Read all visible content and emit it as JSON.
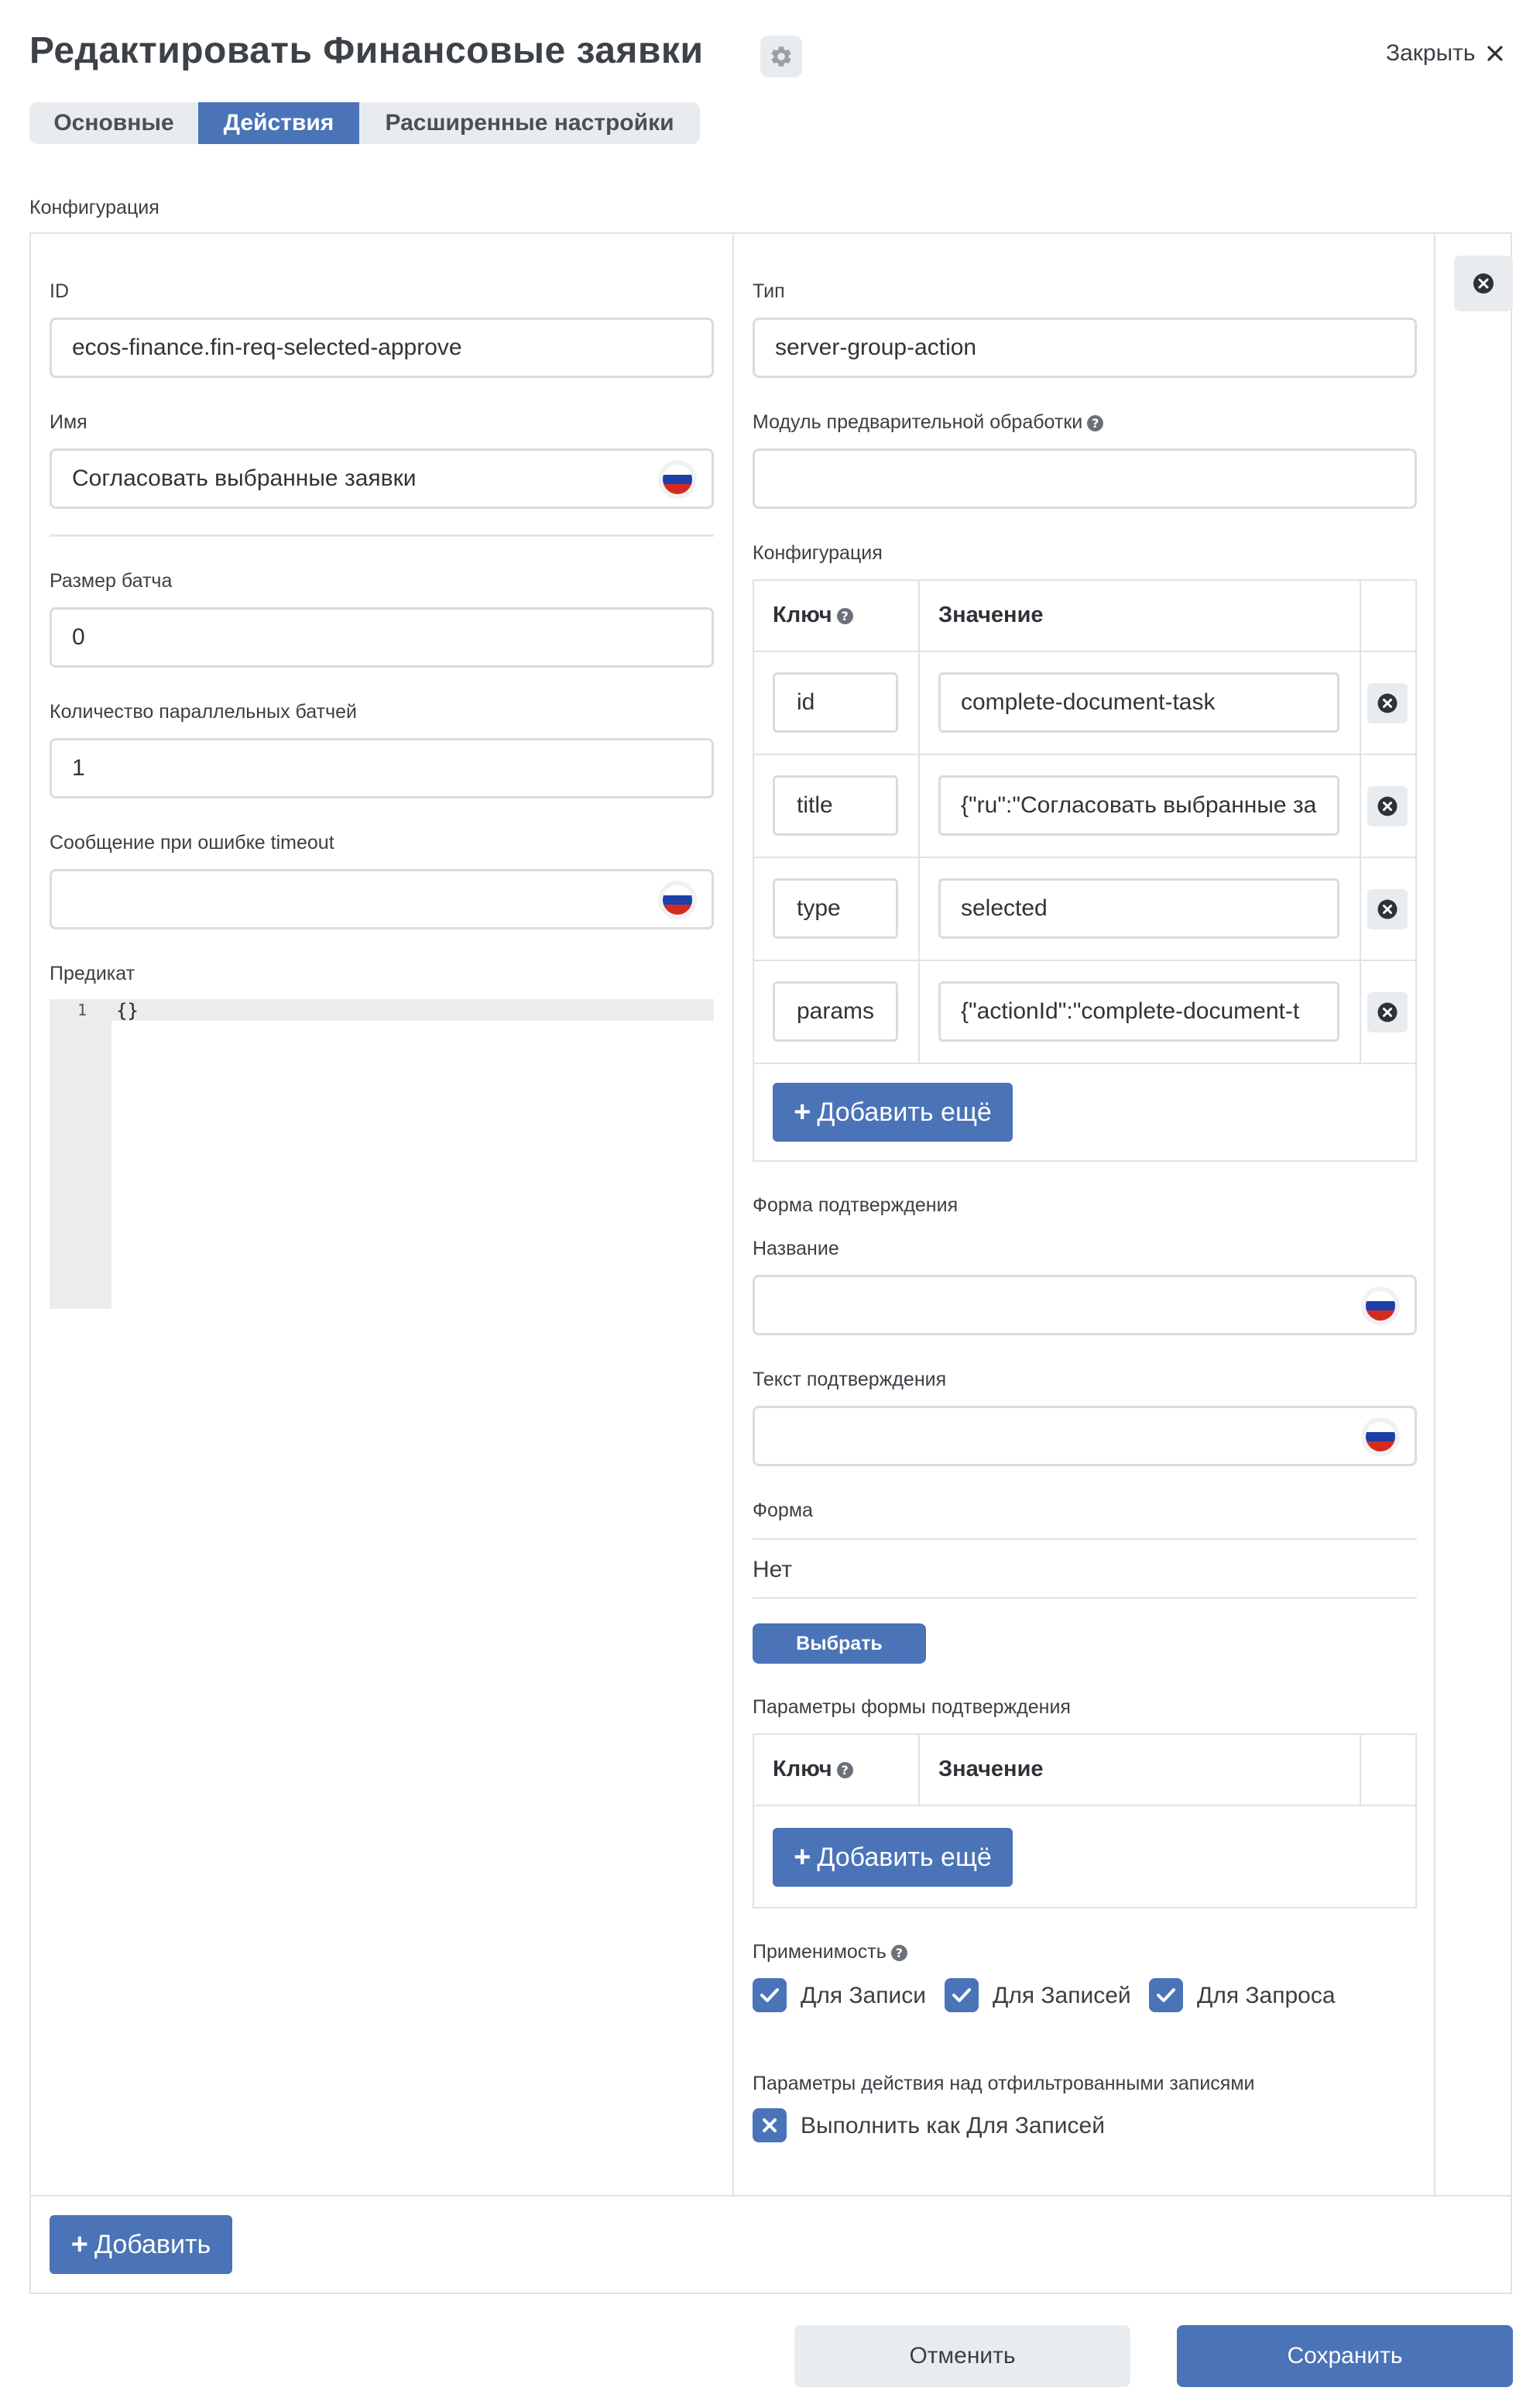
{
  "header": {
    "title": "Редактировать Финансовые заявки",
    "close_label": "Закрыть"
  },
  "tabs": [
    {
      "label": "Основные",
      "active": false
    },
    {
      "label": "Действия",
      "active": true
    },
    {
      "label": "Расширенные настройки",
      "active": false
    }
  ],
  "section_label": "Конфигурация",
  "left": {
    "id_label": "ID",
    "id_value": "ecos-finance.fin-req-selected-approve",
    "name_label": "Имя",
    "name_value": "Согласовать выбранные заявки",
    "batch_size_label": "Размер батча",
    "batch_size_value": "0",
    "parallel_batches_label": "Количество параллельных батчей",
    "parallel_batches_value": "1",
    "timeout_message_label": "Сообщение при ошибке timeout",
    "timeout_message_value": "",
    "predicate_label": "Предикат",
    "predicate_line_number": "1",
    "predicate_code": "{}"
  },
  "right": {
    "type_label": "Тип",
    "type_value": "server-group-action",
    "preprocess_label": "Модуль предварительной обработки",
    "preprocess_value": "",
    "config_label": "Конфигурация",
    "config_table": {
      "key_header": "Ключ",
      "value_header": "Значение",
      "rows": [
        {
          "key": "id",
          "value": "complete-document-task"
        },
        {
          "key": "title",
          "value": "{\"ru\":\"Согласовать выбранные за"
        },
        {
          "key": "type",
          "value": "selected"
        },
        {
          "key": "params",
          "value": "{\"actionId\":\"complete-document-t"
        }
      ],
      "add_more_label": "Добавить ещё"
    },
    "confirm_form_label": "Форма подтверждения",
    "confirm_title_label": "Название",
    "confirm_title_value": "",
    "confirm_text_label": "Текст подтверждения",
    "confirm_text_value": "",
    "form_label": "Форма",
    "form_value": "Нет",
    "select_button": "Выбрать",
    "confirm_params_label": "Параметры формы подтверждения",
    "confirm_params_table": {
      "key_header": "Ключ",
      "value_header": "Значение",
      "add_more_label": "Добавить ещё"
    },
    "applicability_label": "Применимость",
    "applicability_options": [
      {
        "label": "Для Записи",
        "checked": true
      },
      {
        "label": "Для Записей",
        "checked": true
      },
      {
        "label": "Для Запроса",
        "checked": true
      }
    ],
    "filtered_params_label": "Параметры действия над отфильтрованными записями",
    "execute_as_label": "Выполнить как Для Записей"
  },
  "add_button": "Добавить",
  "footer": {
    "cancel_label": "Отменить",
    "save_label": "Сохранить"
  },
  "colors": {
    "primary": "#4a73b8",
    "border": "#d8dce1",
    "muted_bg": "#e9ecef"
  }
}
